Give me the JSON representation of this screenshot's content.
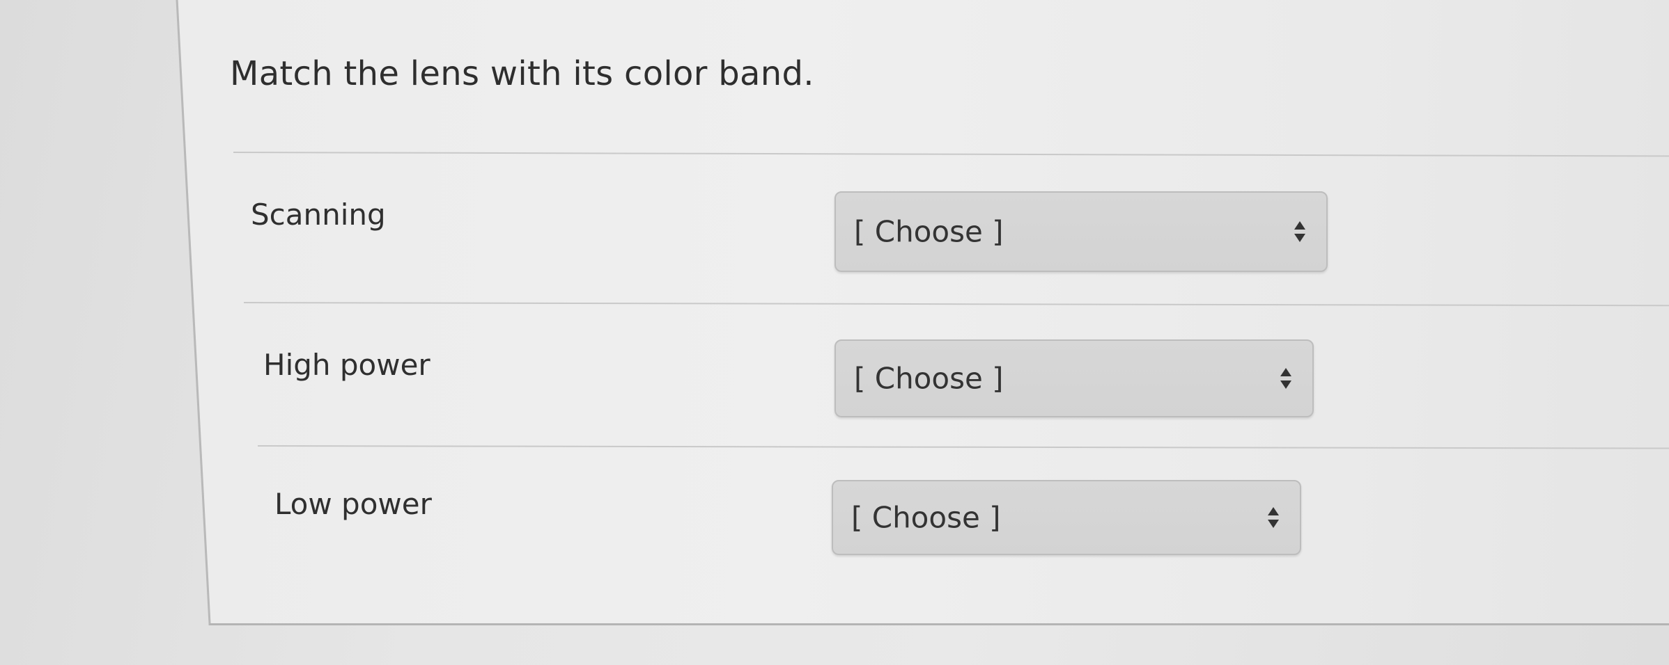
{
  "question": {
    "prompt": "Match the lens with its color band."
  },
  "rows": [
    {
      "label": "Scanning",
      "select_value": "[ Choose ]"
    },
    {
      "label": "High power",
      "select_value": "[ Choose ]"
    },
    {
      "label": "Low power",
      "select_value": "[ Choose ]"
    }
  ],
  "icons": {
    "select_arrow": "up-down-arrows-icon"
  },
  "colors": {
    "background": "#e6e6e6",
    "select_fill": "#d5d5d5",
    "text": "#2e2e2e"
  }
}
